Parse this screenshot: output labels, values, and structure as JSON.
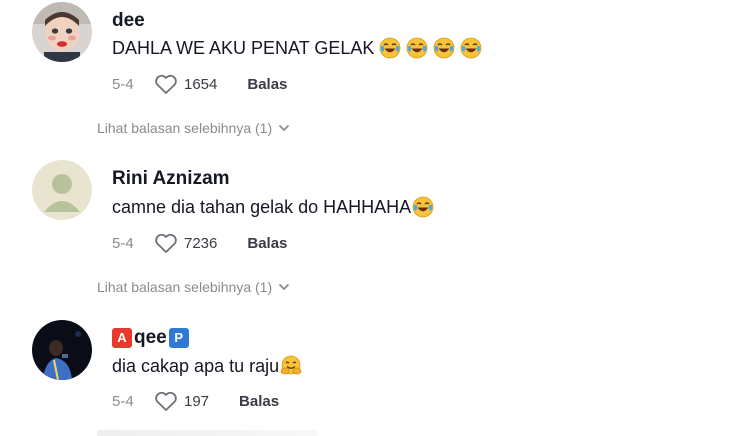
{
  "comments": [
    {
      "username": "dee",
      "text": "DAHLA WE AKU PENAT GELAK",
      "emojis": [
        "crying-laughing-face",
        "crying-laughing-face",
        "crying-laughing-face",
        "crying-laughing-face"
      ],
      "date": "5-4",
      "likes": "1654",
      "reply_label": "Balas",
      "more_replies": "Lihat balasan selebihnya (1)"
    },
    {
      "username": "Rini Aznizam",
      "text": "camne dia tahan gelak do HAHHAHA",
      "emojis": [
        "crying-laughing-face"
      ],
      "date": "5-4",
      "likes": "7236",
      "reply_label": "Balas",
      "more_replies": "Lihat balasan selebihnya (1)"
    },
    {
      "username_badge_left": "A",
      "username": "qee",
      "username_badge_right": "P",
      "text": "dia cakap apa tu raju",
      "emojis": [
        "hugging-face"
      ],
      "date": "5-4",
      "likes": "197",
      "reply_label": "Balas"
    }
  ],
  "colors": {
    "text": "#161823",
    "muted": "#8a8b91",
    "badge_red": "#e8392d",
    "badge_blue": "#2e7ad6"
  }
}
